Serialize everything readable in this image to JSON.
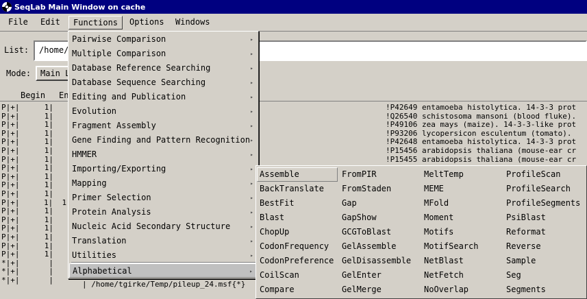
{
  "window": {
    "title": "SeqLab Main Window on cache",
    "icon": "seqlab-app-icon"
  },
  "menubar": {
    "items": [
      "File",
      "Edit",
      "Functions",
      "Options",
      "Windows"
    ],
    "active": "Functions"
  },
  "list": {
    "label": "List:",
    "value": "/home/"
  },
  "mode": {
    "label": "Mode:",
    "value": "Main L"
  },
  "columns": {
    "begin": "Begin",
    "end": "En"
  },
  "sequences": [
    {
      "flags": "P|+|",
      "begin": "1|",
      "desc": "!P42649 entamoeba histolytica. 14-3-3 prot"
    },
    {
      "flags": "P|+|",
      "begin": "1|",
      "desc": "!Q26540 schistosoma mansoni (blood fluke)."
    },
    {
      "flags": "P|+|",
      "begin": "1|",
      "desc": "!P49106 zea mays (maize). 14-3-3-like prot"
    },
    {
      "flags": "P|+|",
      "begin": "1|",
      "desc": "!P93206 lycopersicon esculentum (tomato)."
    },
    {
      "flags": "P|+|",
      "begin": "1|",
      "desc": "!P42648 entamoeba histolytica. 14-3-3 prot"
    },
    {
      "flags": "P|+|",
      "begin": "1|",
      "desc": "!P15456 arabidopsis thaliana (mouse-ear cr"
    },
    {
      "flags": "P|+|",
      "begin": "1|",
      "desc": "!P15455 arabidopsis thaliana (mouse-ear cr"
    },
    {
      "flags": "P|+|",
      "begin": "1|",
      "desc": ""
    },
    {
      "flags": "P|+|",
      "begin": "1|",
      "desc": ""
    },
    {
      "flags": "P|+|",
      "begin": "1|",
      "desc": ""
    },
    {
      "flags": "P|+|",
      "begin": "1|",
      "desc": ""
    },
    {
      "flags": "P|+|",
      "begin": "1|  1",
      "desc": ""
    },
    {
      "flags": "P|+|",
      "begin": "1|",
      "desc": ""
    },
    {
      "flags": "P|+|",
      "begin": "1|",
      "desc": ""
    },
    {
      "flags": "P|+|",
      "begin": "1|",
      "desc": ""
    },
    {
      "flags": "P|+|",
      "begin": "1|",
      "desc": ""
    },
    {
      "flags": "P|+|",
      "begin": "1|",
      "desc": ""
    },
    {
      "flags": "P|+|",
      "begin": "1|",
      "desc": ""
    },
    {
      "flags": "*|+|",
      "begin": "|",
      "desc": ""
    },
    {
      "flags": "*|+|",
      "begin": "|",
      "desc": ""
    },
    {
      "flags": "*|+|",
      "begin": "|",
      "desc": ""
    }
  ],
  "bottom_path": "| /home/tgirke/Temp/pileup_24.msf{*}",
  "functions_menu": {
    "items": [
      "Pairwise Comparison",
      "Multiple Comparison",
      "Database Reference Searching",
      "Database Sequence Searching",
      "Editing and Publication",
      "Evolution",
      "Fragment Assembly",
      "Gene Finding and Pattern Recognition",
      "HMMER",
      "Importing/Exporting",
      "Mapping",
      "Primer Selection",
      "Protein Analysis",
      "Nucleic Acid Secondary Structure",
      "Translation",
      "Utilities"
    ],
    "alphabetical": "Alphabetical",
    "arrow_glyph": "▸"
  },
  "alphabetical_menu": {
    "columns": [
      [
        "Assemble",
        "BackTranslate",
        "BestFit",
        "Blast",
        "ChopUp",
        "CodonFrequency",
        "CodonPreference",
        "CoilScan",
        "Compare"
      ],
      [
        "FromPIR",
        "FromStaden",
        "Gap",
        "GapShow",
        "GCGToBlast",
        "GelAssemble",
        "GelDisassemble",
        "GelEnter",
        "GelMerge"
      ],
      [
        "MeltTemp",
        "MEME",
        "MFold",
        "Moment",
        "Motifs",
        "MotifSearch",
        "NetBlast",
        "NetFetch",
        "NoOverlap"
      ],
      [
        "ProfileScan",
        "ProfileSearch",
        "ProfileSegments",
        "PsiBlast",
        "Reformat",
        "Reverse",
        "Sample",
        "Seg",
        "Segments"
      ]
    ],
    "active": "Assemble"
  }
}
